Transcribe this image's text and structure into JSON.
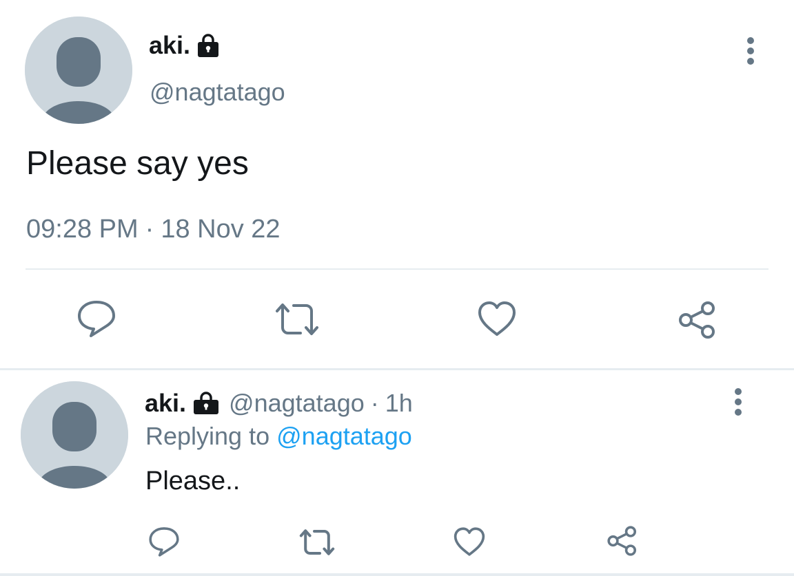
{
  "main_tweet": {
    "display_name": "aki.",
    "handle": "@nagtatago",
    "text": "Please say yes",
    "time": "09:28 PM",
    "separator": "·",
    "date": "18 Nov 22",
    "icons": {
      "protected": "lock-icon",
      "more": "more-vertical-icon",
      "reply": "reply-icon",
      "retweet": "retweet-icon",
      "like": "heart-icon",
      "share": "share-icon"
    }
  },
  "reply_tweet": {
    "display_name": "aki.",
    "handle": "@nagtatago",
    "separator": "·",
    "time": "1h",
    "replying_label": "Replying to",
    "replying_mention": "@nagtatago",
    "text": "Please..",
    "icons": {
      "protected": "lock-icon",
      "more": "more-vertical-icon",
      "reply": "reply-icon",
      "retweet": "retweet-icon",
      "like": "heart-icon",
      "share": "share-icon"
    }
  },
  "colors": {
    "text_primary": "#14171a",
    "text_secondary": "#657786",
    "link": "#1da1f2",
    "icon": "#657786",
    "avatar_bg": "#ccd6dd",
    "avatar_figure": "#657786",
    "divider": "#e6ecf0"
  }
}
